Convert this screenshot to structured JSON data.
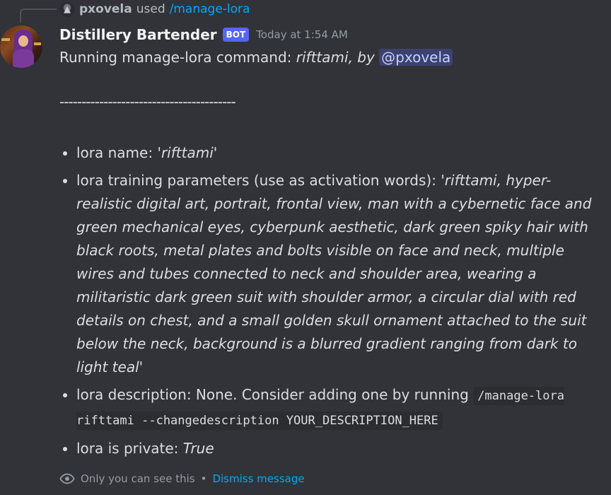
{
  "reply": {
    "user": "pxovela",
    "used_text": "used",
    "command": "/manage-lora"
  },
  "message": {
    "username": "Distillery Bartender",
    "bot_badge": "BOT",
    "timestamp": "Today at 1:54 AM",
    "intro_prefix": "Running manage-lora command: ",
    "intro_lora": "rifttami",
    "intro_by": ", by ",
    "mention": "@pxovela",
    "separator": "----------------------------------------",
    "items": {
      "name_label": "lora name: ",
      "name_value": "'rifttami'",
      "params_label": "lora training parameters (use as activation words): ",
      "params_value": "'rifttami, hyper-realistic digital art, portrait, frontal view, man with a cybernetic face and green mechanical eyes, cyberpunk aesthetic, dark green spiky hair with black roots, metal plates and bolts visible on face and neck, multiple wires and tubes connected to neck and shoulder area, wearing a militaristic dark green suit with shoulder armor, a circular dial with red details on chest, and a small golden skull ornament attached to the suit below the neck, background is a blurred gradient ranging from dark to light teal'",
      "desc_label": "lora description: None. Consider adding one by running ",
      "desc_code": "/manage-lora rifttami --changedescription YOUR_DESCRIPTION_HERE",
      "private_label": "lora is private: ",
      "private_value": "True"
    }
  },
  "footer": {
    "only_you": "Only you can see this",
    "bullet": "•",
    "dismiss": "Dismiss message"
  },
  "colors": {
    "background": "#313338",
    "link": "#00a8fc",
    "bot_badge": "#5865f2",
    "mention_bg": "#3c4270"
  },
  "icons": {
    "reply_avatar": "dragon-avatar-icon",
    "eye": "eye-icon"
  }
}
